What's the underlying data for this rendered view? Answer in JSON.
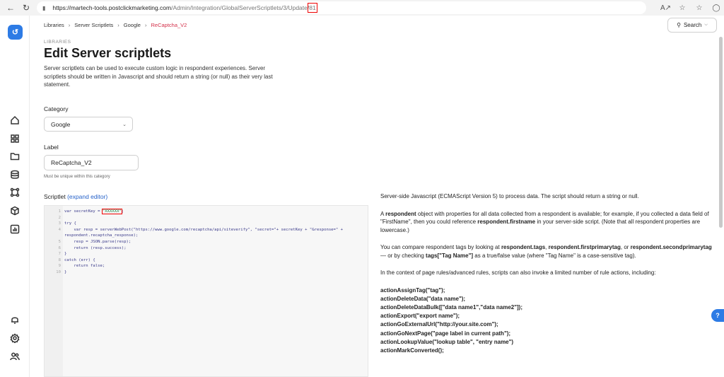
{
  "browser": {
    "url_host": "https://martech-tools.postclickmarketing.com",
    "url_path": "/Admin/Integration/GlobalServerScriptlets/3/Update/",
    "url_id": "81"
  },
  "breadcrumb": {
    "items": [
      "Libraries",
      "Server Scriptlets",
      "Google",
      "ReCaptcha_V2"
    ]
  },
  "search": {
    "label": "Search"
  },
  "header": {
    "eyebrow": "LIBRARIES",
    "title": "Edit Server scriptlets",
    "description": "Server scriptlets can be used to execute custom logic in respondent experiences. Server scriptlets should be written in Javascript and should return a string (or null) as their very last statement."
  },
  "form": {
    "category_label": "Category",
    "category_value": "Google",
    "label_label": "Label",
    "label_value": "ReCaptcha_V2",
    "label_hint": "Must be unique within this category",
    "scriptlet_label": "Scriptlet",
    "expand_editor": "(expand editor)"
  },
  "code": {
    "lines": [
      {
        "n": "1",
        "a": "var secretKey = ",
        "b": "\"XXXXXX\"",
        "c": ";"
      },
      {
        "n": "2",
        "a": "",
        "b": "",
        "c": ""
      },
      {
        "n": "3",
        "a": "try {",
        "b": "",
        "c": ""
      },
      {
        "n": "4",
        "a": "    var resp = serverWebPost(\"https://www.google.com/recaptcha/api/siteverify\", \"secret=\"+ secretKey + \"&response=\" +",
        "b": "",
        "c": ""
      },
      {
        "n": "",
        "a": "respondent.recaptcha_response);",
        "b": "",
        "c": ""
      },
      {
        "n": "5",
        "a": "    resp = JSON.parse(resp);",
        "b": "",
        "c": ""
      },
      {
        "n": "6",
        "a": "    return (resp.success);",
        "b": "",
        "c": ""
      },
      {
        "n": "7",
        "a": "}",
        "b": "",
        "c": ""
      },
      {
        "n": "8",
        "a": "catch (err) {",
        "b": "",
        "c": ""
      },
      {
        "n": "9",
        "a": "    return false;",
        "b": "",
        "c": ""
      },
      {
        "n": "10",
        "a": "}",
        "b": "",
        "c": ""
      }
    ]
  },
  "help": {
    "p1": "Server-side Javascript (ECMAScript Version 5) to process data. The script should return a string or null.",
    "p2_pre": "A ",
    "p2_b1": "respondent",
    "p2_mid": " object with properties for all data collected from a respondent is available; for example, if you collected a data field of \"FirstName\", then you could reference ",
    "p2_b2": "respondent.firstname",
    "p2_post": " in your server-side script. (Note that all respondent properties are lowercase.)",
    "p3_pre": "You can compare respondent tags by looking at ",
    "p3_b1": "respondent.tags",
    "p3_s1": ", ",
    "p3_b2": "respondent.firstprimarytag",
    "p3_s2": ", or ",
    "p3_b3": "respondent.secondprimarytag",
    "p3_s3": " — or by checking ",
    "p3_b4": "tags[\"Tag Name\"]",
    "p3_post": " as a true/false value (where \"Tag Name\" is a case-sensitive tag).",
    "p4": "In the context of page rules/advanced rules, scripts can also invoke a limited number of rule actions, including:",
    "actions": [
      "actionAssignTag(\"tag\");",
      "actionDeleteData(\"data name\");",
      "actionDeleteDataBulk([\"data name1\",\"data name2\"]);",
      "actionExport(\"export name\");",
      "actionGoExternalUrl(\"http://your.site.com\");",
      "actionGoNextPage(\"page label in current path\");",
      "actionLookupValue(\"lookup table\", \"entry name\")",
      "actionMarkConverted();"
    ]
  }
}
